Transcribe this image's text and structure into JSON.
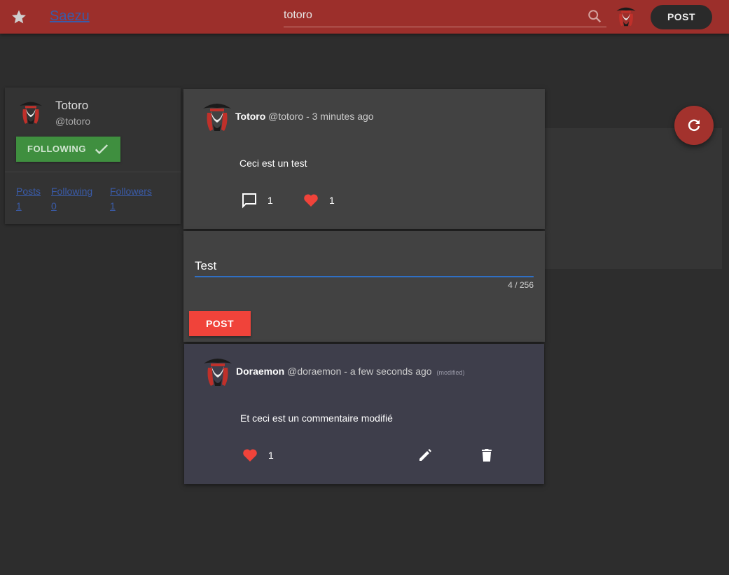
{
  "header": {
    "brand": "Saezu",
    "search_value": "totoro",
    "post_label": "POST",
    "star_icon": "star-icon",
    "search_icon": "search-icon"
  },
  "profile": {
    "name": "Totoro",
    "handle": "@totoro",
    "following_label": "FOLLOWING",
    "stats": [
      {
        "label": "Posts",
        "value": "1"
      },
      {
        "label": "Following",
        "value": "0"
      },
      {
        "label": "Followers",
        "value": "1"
      }
    ]
  },
  "post": {
    "author": "Totoro",
    "handle": "@totoro",
    "time": "- 3 minutes ago",
    "text": "Ceci est un test",
    "comment_count": "1",
    "like_count": "1"
  },
  "reply": {
    "value": "Test",
    "counter": "4 / 256",
    "post_label": "POST"
  },
  "comment": {
    "author": "Doraemon",
    "handle": "@doraemon",
    "time": "- a few seconds ago",
    "modified": "(modified)",
    "text": "Et ceci est un commentaire modifié",
    "like_count": "1"
  },
  "colors": {
    "topbar": "#9c2f2b",
    "accent_red": "#f0433a",
    "following_green": "#3f8f3f",
    "link_blue": "#3a5ba8"
  }
}
